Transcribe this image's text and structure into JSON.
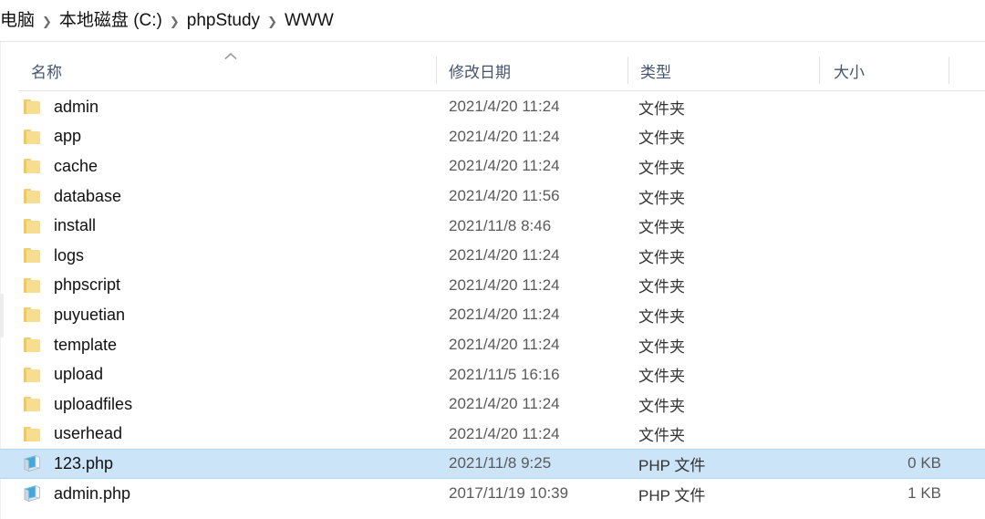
{
  "window": {
    "type": "windows-file-explorer",
    "selection_color": "#cce4f7",
    "header_text_color": "#44546f"
  },
  "breadcrumb": {
    "name": "address-breadcrumb",
    "separator": "❯",
    "items": [
      {
        "label": "电脑",
        "truncated": true
      },
      {
        "label": "本地磁盘 (C:)"
      },
      {
        "label": "phpStudy"
      },
      {
        "label": "WWW"
      }
    ]
  },
  "columns": [
    {
      "key": "name",
      "label": "名称",
      "sorted": true,
      "sort_direction": "ascending"
    },
    {
      "key": "date",
      "label": "修改日期",
      "sorted": false
    },
    {
      "key": "type",
      "label": "类型",
      "sorted": false
    },
    {
      "key": "size",
      "label": "大小",
      "sorted": false
    }
  ],
  "files": [
    {
      "name": "admin",
      "date": "2021/4/20 11:24",
      "type": "文件夹",
      "size": "",
      "icon": "folder-icon",
      "selected": false
    },
    {
      "name": "app",
      "date": "2021/4/20 11:24",
      "type": "文件夹",
      "size": "",
      "icon": "folder-icon",
      "selected": false
    },
    {
      "name": "cache",
      "date": "2021/4/20 11:24",
      "type": "文件夹",
      "size": "",
      "icon": "folder-icon",
      "selected": false
    },
    {
      "name": "database",
      "date": "2021/4/20 11:56",
      "type": "文件夹",
      "size": "",
      "icon": "folder-icon",
      "selected": false
    },
    {
      "name": "install",
      "date": "2021/11/8 8:46",
      "type": "文件夹",
      "size": "",
      "icon": "folder-icon",
      "selected": false
    },
    {
      "name": "logs",
      "date": "2021/4/20 11:24",
      "type": "文件夹",
      "size": "",
      "icon": "folder-icon",
      "selected": false
    },
    {
      "name": "phpscript",
      "date": "2021/4/20 11:24",
      "type": "文件夹",
      "size": "",
      "icon": "folder-icon",
      "selected": false
    },
    {
      "name": "puyuetian",
      "date": "2021/4/20 11:24",
      "type": "文件夹",
      "size": "",
      "icon": "folder-icon",
      "selected": false
    },
    {
      "name": "template",
      "date": "2021/4/20 11:24",
      "type": "文件夹",
      "size": "",
      "icon": "folder-icon",
      "selected": false
    },
    {
      "name": "upload",
      "date": "2021/11/5 16:16",
      "type": "文件夹",
      "size": "",
      "icon": "folder-icon",
      "selected": false
    },
    {
      "name": "uploadfiles",
      "date": "2021/4/20 11:24",
      "type": "文件夹",
      "size": "",
      "icon": "folder-icon",
      "selected": false
    },
    {
      "name": "userhead",
      "date": "2021/4/20 11:24",
      "type": "文件夹",
      "size": "",
      "icon": "folder-icon",
      "selected": false
    },
    {
      "name": "123.php",
      "date": "2021/11/8 9:25",
      "type": "PHP 文件",
      "size": "0 KB",
      "icon": "php-file-icon",
      "selected": true
    },
    {
      "name": "admin.php",
      "date": "2017/11/19 10:39",
      "type": "PHP 文件",
      "size": "1 KB",
      "icon": "php-file-icon",
      "selected": false
    }
  ]
}
